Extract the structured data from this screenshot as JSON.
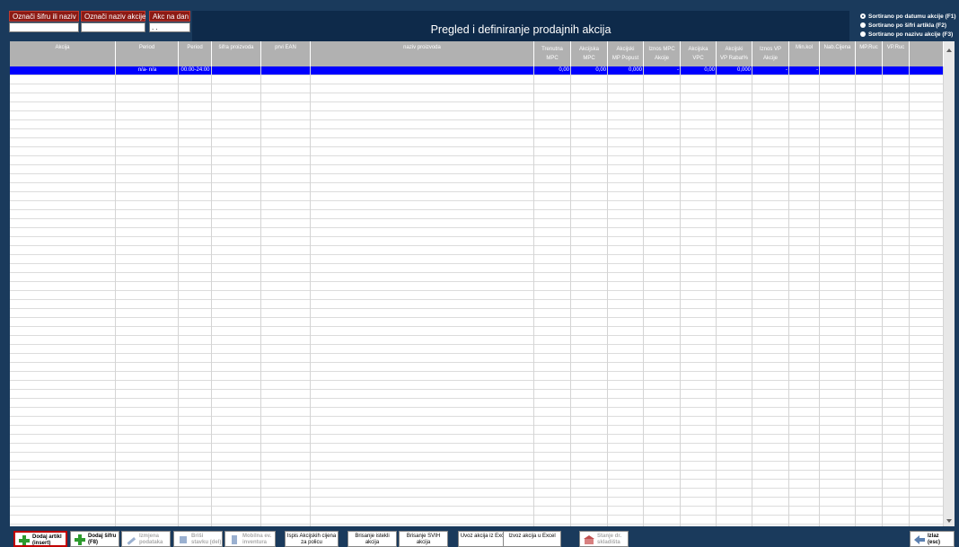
{
  "filters": {
    "search_label": "Označi šifru ili naziv",
    "search_value": "",
    "action_name_label": "Označi naziv akcije",
    "action_name_value": "",
    "action_date_label": "Akc na dan",
    "action_date_value": ". ."
  },
  "header": {
    "title": "Pregled i definiranje prodajnih akcija"
  },
  "sort": {
    "options": [
      {
        "label": "Sortirano po datumu akcije (F1)",
        "selected": true
      },
      {
        "label": "Sortirano po šifri artikla (F2)",
        "selected": false
      },
      {
        "label": "Sortirano po nazivu akcije (F3)",
        "selected": false
      }
    ]
  },
  "grid": {
    "columns": [
      {
        "l1": "Akcija",
        "l2": ""
      },
      {
        "l1": "Period",
        "l2": ""
      },
      {
        "l1": "Period",
        "l2": ""
      },
      {
        "l1": "šifra proizvoda",
        "l2": ""
      },
      {
        "l1": "prvi EAN",
        "l2": ""
      },
      {
        "l1": "naziv proizvoda",
        "l2": ""
      },
      {
        "l1": "Trenutna",
        "l2": "MPC"
      },
      {
        "l1": "Akcijska",
        "l2": "MPC"
      },
      {
        "l1": "Akcijski",
        "l2": "MP Popust"
      },
      {
        "l1": "Iznos MPC",
        "l2": "Akcije"
      },
      {
        "l1": "Akcijska",
        "l2": "VPC"
      },
      {
        "l1": "Akcijski",
        "l2": "VP Rabat%"
      },
      {
        "l1": "Iznos VP",
        "l2": "Akcije"
      },
      {
        "l1": "Min.kol",
        "l2": ""
      },
      {
        "l1": "Nab.Cijena",
        "l2": ""
      },
      {
        "l1": "MP.Ruc",
        "l2": ""
      },
      {
        "l1": "VP.Ruc",
        "l2": ""
      },
      {
        "l1": "",
        "l2": ""
      }
    ],
    "selected_row": [
      "",
      "n/a- n/a",
      "00:00-24:00",
      "",
      "",
      "",
      "0,00",
      "0,00",
      "0,000",
      "-",
      "0,00",
      "0,000",
      "-",
      "-",
      "",
      "",
      "",
      ""
    ]
  },
  "toolbar": {
    "buttons": [
      {
        "label": "Dodaj artikl (insert)",
        "icon": "plus-icon",
        "state": "active"
      },
      {
        "label": "Dodaj šifru (F8)",
        "icon": "plus-icon",
        "state": "enabled"
      },
      {
        "label": "Izmjena podataka",
        "icon": "edit-icon",
        "state": "disabled"
      },
      {
        "label": "Briši stavku (del)",
        "icon": "delete-icon",
        "state": "disabled"
      },
      {
        "label": "Mobilna ev. inventura (F7)",
        "icon": "mobile-icon",
        "state": "disabled"
      },
      {
        "label": "Ispis Akcijskih cijena za policu",
        "icon": "",
        "state": "enabled"
      },
      {
        "label": "Brisanje istekli akcija",
        "icon": "",
        "state": "enabled"
      },
      {
        "label": "Brisanje SVIH akcija",
        "icon": "",
        "state": "enabled"
      },
      {
        "label": "Uvoz akcija iz Excela",
        "icon": "",
        "state": "enabled"
      },
      {
        "label": "Izvoz akcija u Excel",
        "icon": "",
        "state": "enabled"
      },
      {
        "label": "Stanje dr. skladišta",
        "icon": "warehouse-icon",
        "state": "disabled"
      }
    ],
    "exit_label": "Izlaz (esc)"
  },
  "colors": {
    "background": "#1a3a5c",
    "selection": "#0000ff",
    "filter_label": "#8c1a14",
    "header_gray": "#b1b1b1"
  }
}
